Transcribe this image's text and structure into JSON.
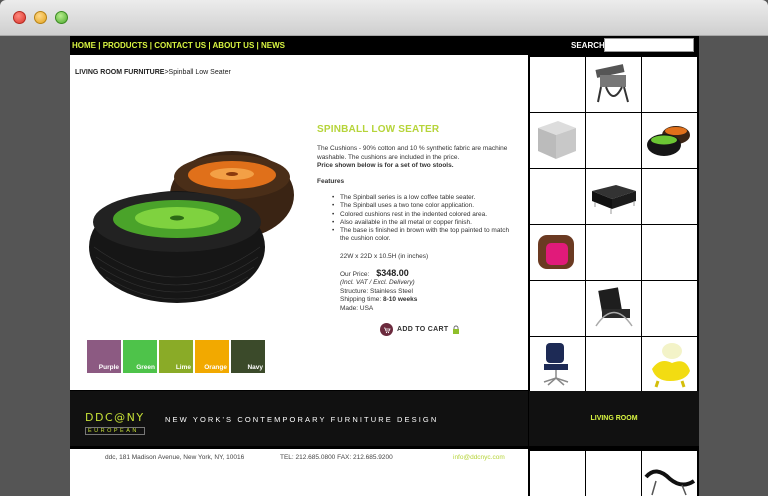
{
  "nav": {
    "items": [
      "HOME",
      "PRODUCTS",
      "CONTACT US",
      "ABOUT US",
      "NEWS"
    ],
    "search_label": "SEARCH",
    "search_value": ""
  },
  "breadcrumb": {
    "category": "LIVING ROOM FURNITURE",
    "separator": ">",
    "current": "Spinball Low Seater"
  },
  "product": {
    "title": "SPINBALL LOW SEATER",
    "description": "The Cushions - 90% cotton and 10 % synthetic fabric are machine washable. The cushions are included in the price.",
    "price_note": "Price shown below is for a set of two stools.",
    "features_heading": "Features",
    "features": [
      "The Spinball series is a low coffee table seater.",
      "The Spinball uses a two tone color application.",
      "Colored cushions rest in the indented colored area.",
      "Also available in the all metal or copper finish.",
      "The base is finished in brown with the top painted to match the cushion color."
    ],
    "dimensions": "22W x 22D x 10.5H (in inches)",
    "price_label": "Our Price:",
    "price": "$348.00",
    "tax_note": "(Incl. VAT / Excl. Delivery)",
    "structure": "Structure: Stainless Steel",
    "shipping_label": "Shipping time:",
    "shipping_value": "8-10 weeks",
    "made": "Made: USA",
    "add_to_cart": "ADD TO CART"
  },
  "swatches": [
    {
      "label": "Purple",
      "color": "#8c5a82"
    },
    {
      "label": "Green",
      "color": "#4ec34a"
    },
    {
      "label": "Lime",
      "color": "#8aab27"
    },
    {
      "label": "Orange",
      "color": "#f2a900"
    },
    {
      "label": "Navy",
      "color": "#3b4a2a"
    }
  ],
  "footer": {
    "logo_main": "DDC@NY",
    "logo_sub": "EUROPEAN",
    "tagline": "NEW YORK'S CONTEMPORARY FURNITURE DESIGN",
    "living_room": "LIVING ROOM",
    "address": "ddc, 181 Madison Avenue, New York, NY, 10016",
    "phone": "TEL: 212.685.0800 FAX: 212.685.9200",
    "email": "info@ddcnyc.com"
  },
  "colors": {
    "accent_lime": "#d9f542",
    "title_green": "#b6d43a",
    "cushion_green": "#64c02d",
    "cushion_orange": "#e0701a"
  }
}
